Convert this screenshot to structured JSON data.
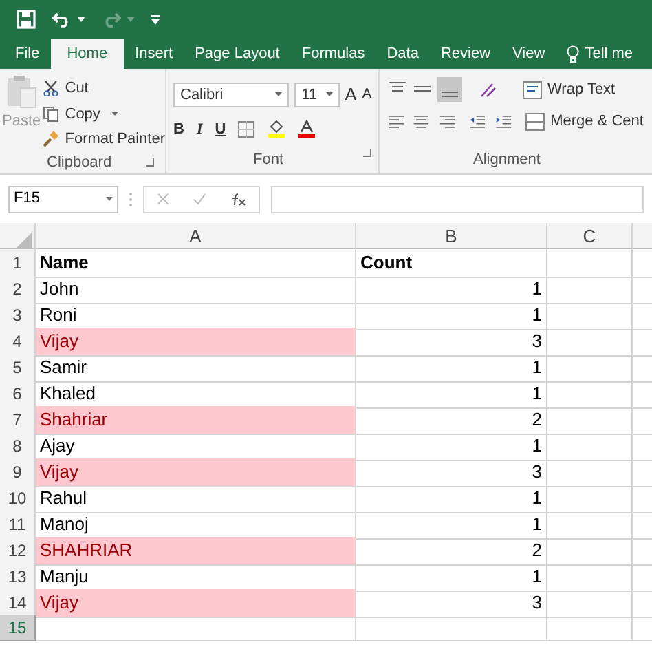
{
  "tabs": [
    {
      "label": "File",
      "selected": false
    },
    {
      "label": "Home",
      "selected": true
    },
    {
      "label": "Insert",
      "selected": false
    },
    {
      "label": "Page Layout",
      "selected": false
    },
    {
      "label": "Formulas",
      "selected": false
    },
    {
      "label": "Data",
      "selected": false
    },
    {
      "label": "Review",
      "selected": false
    },
    {
      "label": "View",
      "selected": false
    }
  ],
  "tell_me": "Tell me",
  "clipboard": {
    "paste": "Paste",
    "cut": "Cut",
    "copy": "Copy",
    "format_painter": "Format Painter",
    "group_label": "Clipboard"
  },
  "font": {
    "name": "Calibri",
    "size": "11",
    "grow": "A",
    "shrink": "A",
    "bold": "B",
    "italic": "I",
    "underline": "U",
    "group_label": "Font"
  },
  "alignment": {
    "wrap_text": "Wrap Text",
    "merge": "Merge & Cent",
    "group_label": "Alignment"
  },
  "formula_bar": {
    "name_box": "F15"
  },
  "columns": [
    {
      "label": "A"
    },
    {
      "label": "B"
    },
    {
      "label": "C"
    }
  ],
  "rows": [
    {
      "number": "1",
      "kind": "header",
      "name": "Name",
      "count": "Count",
      "highlighted": false,
      "selected": false
    },
    {
      "number": "2",
      "kind": "data",
      "name": "John",
      "count": "1",
      "highlighted": false,
      "selected": false
    },
    {
      "number": "3",
      "kind": "data",
      "name": "Roni",
      "count": "1",
      "highlighted": false,
      "selected": false
    },
    {
      "number": "4",
      "kind": "data",
      "name": "Vijay",
      "count": "3",
      "highlighted": true,
      "selected": false
    },
    {
      "number": "5",
      "kind": "data",
      "name": "Samir",
      "count": "1",
      "highlighted": false,
      "selected": false
    },
    {
      "number": "6",
      "kind": "data",
      "name": "Khaled",
      "count": "1",
      "highlighted": false,
      "selected": false
    },
    {
      "number": "7",
      "kind": "data",
      "name": "Shahriar",
      "count": "2",
      "highlighted": true,
      "selected": false
    },
    {
      "number": "8",
      "kind": "data",
      "name": "Ajay",
      "count": "1",
      "highlighted": false,
      "selected": false
    },
    {
      "number": "9",
      "kind": "data",
      "name": "Vijay",
      "count": "3",
      "highlighted": true,
      "selected": false
    },
    {
      "number": "10",
      "kind": "data",
      "name": "Rahul",
      "count": "1",
      "highlighted": false,
      "selected": false
    },
    {
      "number": "11",
      "kind": "data",
      "name": "Manoj",
      "count": "1",
      "highlighted": false,
      "selected": false
    },
    {
      "number": "12",
      "kind": "data",
      "name": "SHAHRIAR",
      "count": "2",
      "highlighted": true,
      "selected": false
    },
    {
      "number": "13",
      "kind": "data",
      "name": "Manju",
      "count": "1",
      "highlighted": false,
      "selected": false
    },
    {
      "number": "14",
      "kind": "data",
      "name": "Vijay",
      "count": "3",
      "highlighted": true,
      "selected": false
    },
    {
      "number": "15",
      "kind": "empty",
      "highlighted": false,
      "selected": true
    }
  ]
}
